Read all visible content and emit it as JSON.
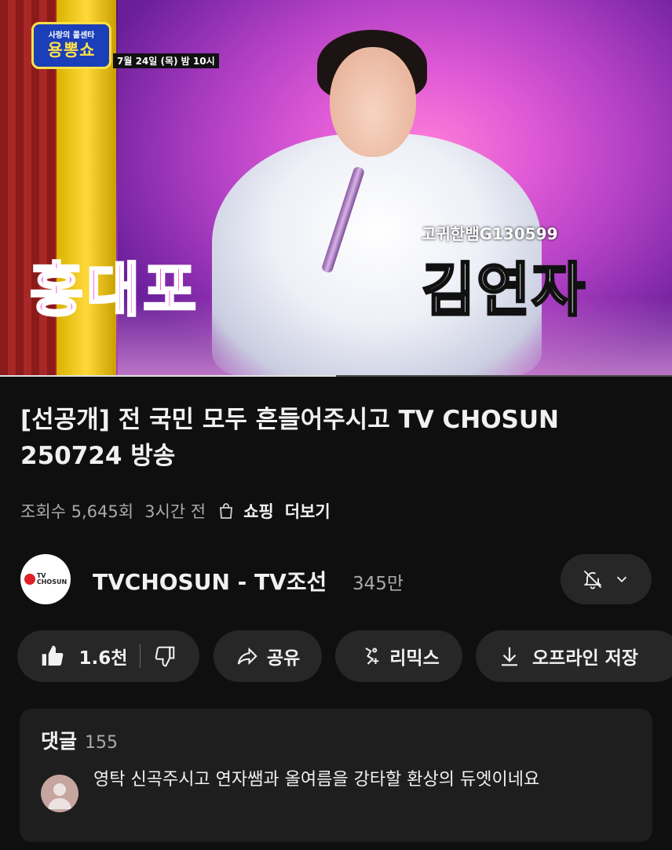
{
  "video": {
    "show_logo_top": "사랑의 콜센타",
    "show_logo_main": "용뽕쇼",
    "air_date": "7월 24일 (목) 밤 10시",
    "watermark": "고귀한뱀G130599",
    "caption_left": "홍대포",
    "caption_right": "김연자",
    "progress": 0.5
  },
  "title": "[선공개] 전 국민 모두 흔들어주시고 TV CHOSUN 250724 방송",
  "meta": {
    "views": "조회수 5,645회",
    "time_ago": "3시간 전",
    "shopping": "쇼핑",
    "more": "더보기"
  },
  "channel": {
    "avatar_text_line1": "TV",
    "avatar_text_line2": "CHOSUN",
    "name": "TVCHOSUN - TV조선",
    "subscribers": "345만"
  },
  "actions": {
    "likes": "1.6천",
    "share": "공유",
    "remix": "리믹스",
    "offline_save": "오프라인 저장"
  },
  "comments": {
    "title": "댓글",
    "count": "155",
    "top_comment": "영탁 신곡주시고 연자쌤과 올여름을  강타할 환상의 듀엣이네요"
  },
  "icons": [
    "shopping-bag-icon",
    "bell-off-icon",
    "chevron-down-icon",
    "thumb-up-icon",
    "thumb-down-icon",
    "share-icon",
    "remix-icon",
    "download-icon",
    "user-avatar-icon"
  ]
}
